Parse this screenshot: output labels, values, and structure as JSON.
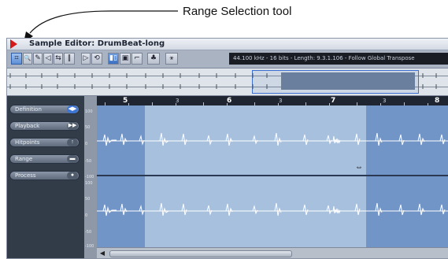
{
  "callout": {
    "label": "Range Selection tool"
  },
  "window": {
    "title": "Sample Editor: DrumBeat-long"
  },
  "toolbar": {
    "tools": [
      {
        "name": "range-selection-tool",
        "glyph": "⌗",
        "selected": true
      },
      {
        "name": "zoom-tool",
        "glyph": "🔍"
      },
      {
        "name": "draw-tool",
        "glyph": "✎"
      },
      {
        "name": "play-tool",
        "glyph": "◁"
      },
      {
        "name": "scrub-tool",
        "glyph": "⇆"
      },
      {
        "name": "hitpoint-tool",
        "glyph": "‖"
      }
    ],
    "info": "44.100 kHz - 16 bits - Length: 9.3.1.106 - Follow Global Transpose"
  },
  "sidebar": {
    "items": [
      {
        "label": "Definition",
        "icon": "◀▶",
        "active": true
      },
      {
        "label": "Playback",
        "icon": "▶▶"
      },
      {
        "label": "Hitpoints",
        "icon": "↑"
      },
      {
        "label": "Range",
        "icon": "▬"
      },
      {
        "label": "Process",
        "icon": "●"
      }
    ]
  },
  "ruler": {
    "bars": [
      "5",
      "6",
      "7",
      "8"
    ],
    "beats": [
      "3",
      "3",
      "3"
    ]
  },
  "vscale": {
    "labels": [
      "100",
      "50",
      "0",
      "-50",
      "-100",
      "100",
      "50",
      "0",
      "-50",
      "-100"
    ]
  }
}
